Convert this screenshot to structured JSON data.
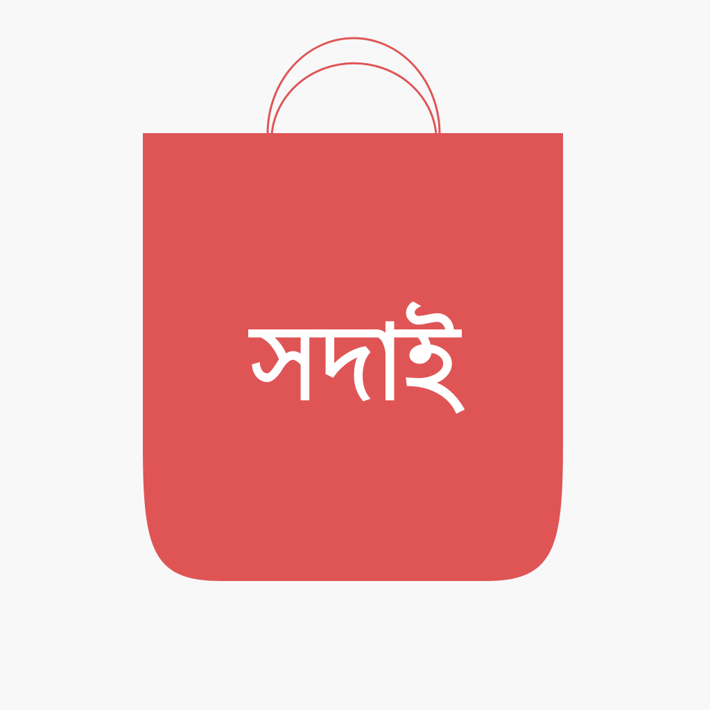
{
  "app_icon": {
    "brand_name": "সদাই",
    "icon_name": "shopping-bag-icon",
    "colors": {
      "background": "#f8f8f9",
      "bag": "#df5556",
      "handle": "#df5556",
      "text": "#ffffff"
    }
  }
}
